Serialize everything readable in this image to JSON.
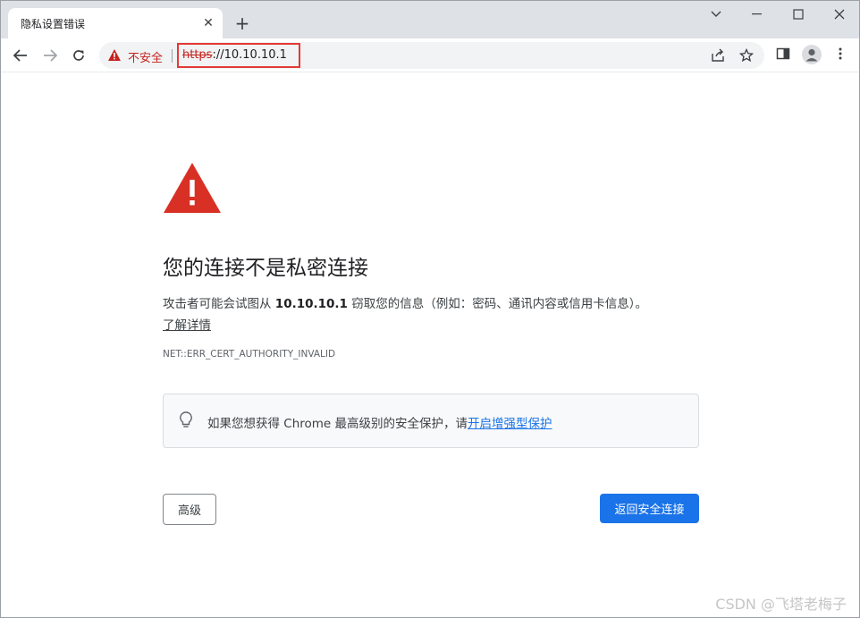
{
  "tab": {
    "title": "隐私设置错误",
    "close_glyph": "✕",
    "new_tab_glyph": "+"
  },
  "window_controls": [
    "chevron-down-icon",
    "minimize-icon",
    "maximize-icon",
    "close-icon"
  ],
  "omnibox": {
    "security_label": "不安全",
    "url_scheme": "https",
    "url_rest": "://10.10.10.1"
  },
  "page": {
    "title": "您的连接不是私密连接",
    "message_before": "攻击者可能会试图从 ",
    "message_host": "10.10.10.1",
    "message_after": " 窃取您的信息（例如：密码、通讯内容或信用卡信息）。",
    "learn_more": "了解详情",
    "error_code": "NET::ERR_CERT_AUTHORITY_INVALID",
    "promo_text": "如果您想获得 Chrome 最高级别的安全保护，请",
    "promo_link": "开启增强型保护",
    "advanced_button": "高级",
    "back_button": "返回安全连接"
  },
  "watermark": "CSDN @飞塔老梅子",
  "colors": {
    "danger_red": "#d93025",
    "primary_blue": "#1a73e8",
    "highlight_box": "#e53935"
  }
}
